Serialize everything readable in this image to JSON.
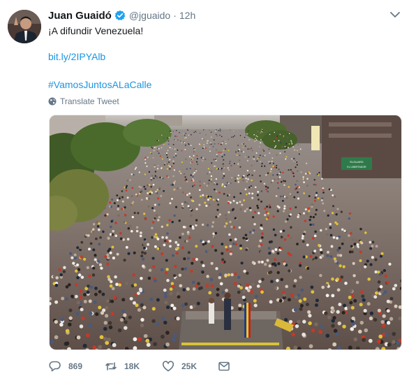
{
  "tweet": {
    "author": {
      "name": "Juan Guaidó",
      "handle": "@jguaido",
      "separator": "·",
      "time": "12h"
    },
    "text": "¡A difundir Venezuela!",
    "link": "bit.ly/2IPYAlb",
    "hashtag": "#VamosJuntosALaCalle",
    "translate_label": "Translate Tweet",
    "media": {
      "sign_text_1": "ELGUARD",
      "sign_text_2": "EL LIBERTADOR"
    },
    "actions": {
      "replies": "869",
      "retweets": "18K",
      "likes": "25K"
    }
  },
  "colors": {
    "link": "#1b95e0",
    "secondary_text": "#657786",
    "verified": "#1da1f2"
  },
  "icons": [
    "caret-down-icon",
    "verified-badge-icon",
    "globe-icon",
    "reply-icon",
    "retweet-icon",
    "like-icon",
    "message-icon"
  ]
}
